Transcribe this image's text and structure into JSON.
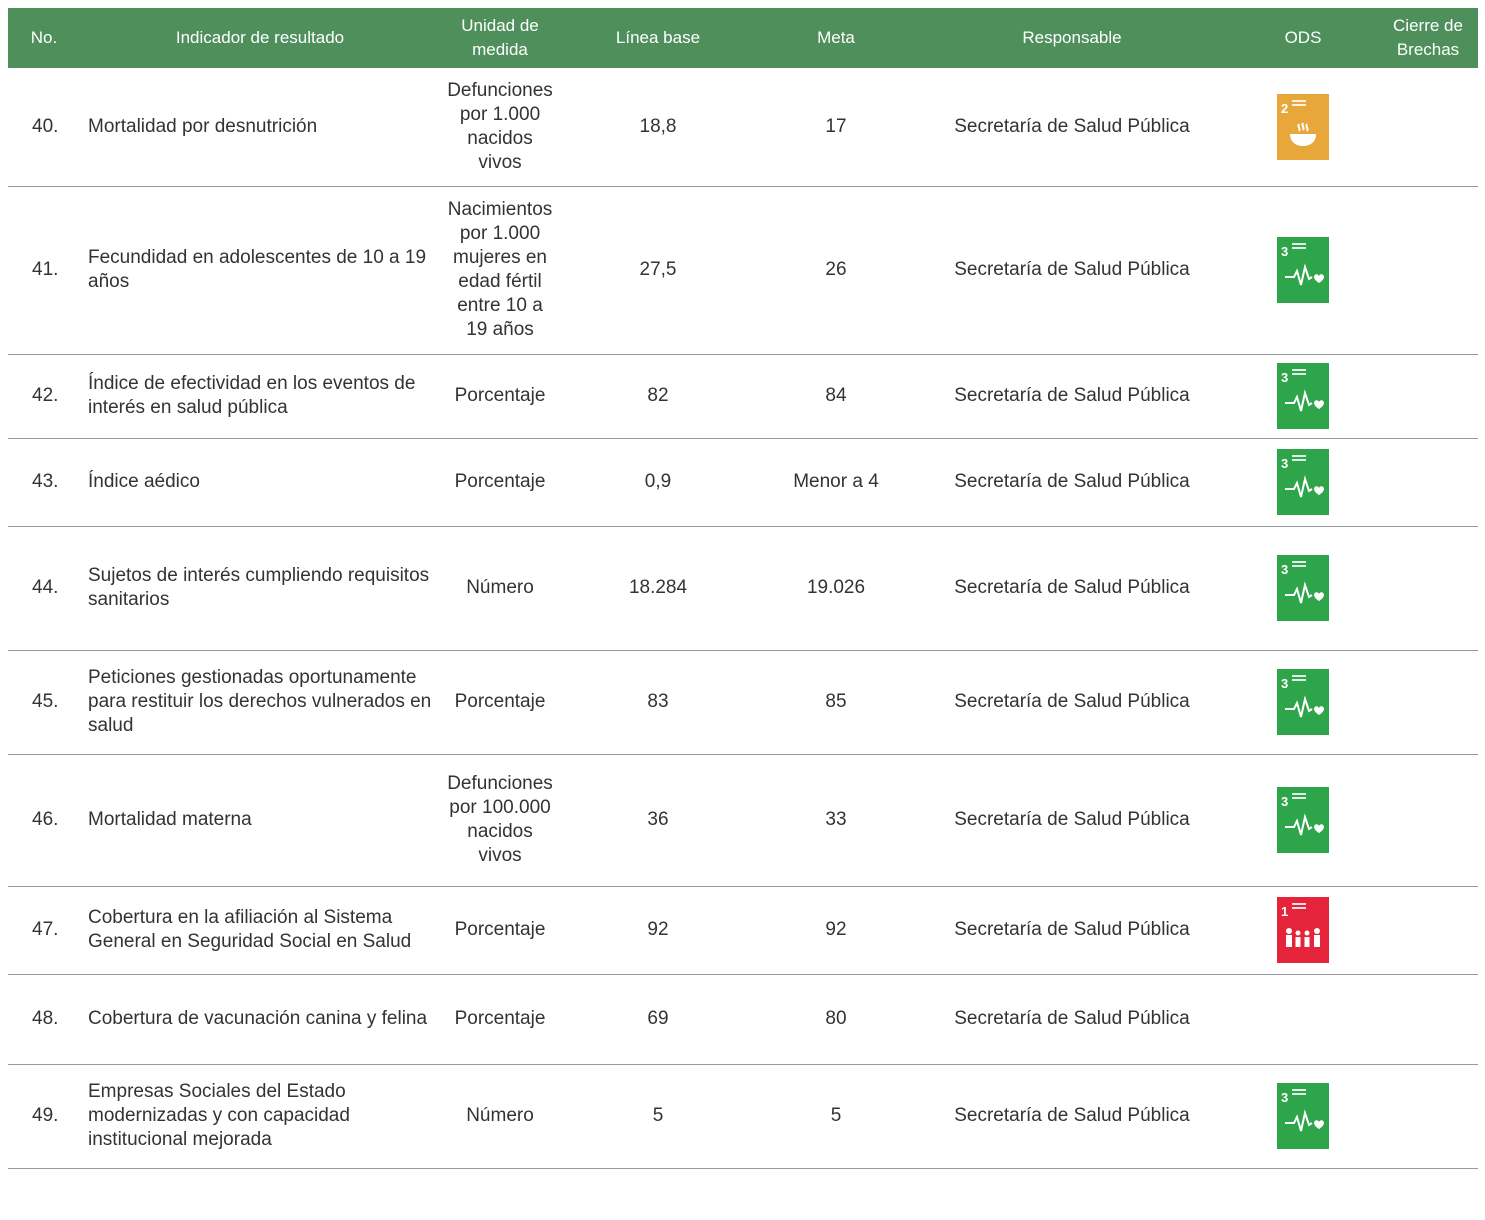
{
  "colors": {
    "header_bg": "#4f8f5c",
    "ods_2": "#e7a73b",
    "ods_3": "#2ea44b",
    "ods_1": "#e5243b"
  },
  "header": {
    "no": "No.",
    "indicador": "Indicador de resultado",
    "unidad": "Unidad de medida",
    "linea_base": "Línea base",
    "meta": "Meta",
    "responsable": "Responsable",
    "ods": "ODS",
    "cierre": "Cierre de Brechas"
  },
  "rows": [
    {
      "no": "40.",
      "indicador": "Mortalidad por desnutrición",
      "unidad": "Defunciones por 1.000 nacidos vivos",
      "linea_base": "18,8",
      "meta": "17",
      "responsable": "Secretaría de Salud Pública",
      "ods": {
        "number": "2",
        "icon": "bowl-icon",
        "color": "#e7a73b"
      }
    },
    {
      "no": "41.",
      "indicador": "Fecundidad en adolescentes de 10 a 19 años",
      "unidad": "Nacimientos por 1.000 mujeres en edad fértil entre 10 a 19 años",
      "linea_base": "27,5",
      "meta": "26",
      "responsable": "Secretaría de Salud Pública",
      "ods": {
        "number": "3",
        "icon": "heartbeat-icon",
        "color": "#2ea44b"
      }
    },
    {
      "no": "42.",
      "indicador": "Índice de efectividad en los eventos de interés en salud pública",
      "unidad": "Porcentaje",
      "linea_base": "82",
      "meta": "84",
      "responsable": "Secretaría de Salud Pública",
      "ods": {
        "number": "3",
        "icon": "heartbeat-icon",
        "color": "#2ea44b"
      }
    },
    {
      "no": "43.",
      "indicador": "Índice aédico",
      "unidad": "Porcentaje",
      "linea_base": "0,9",
      "meta": "Menor a 4",
      "responsable": "Secretaría de Salud Pública",
      "ods": {
        "number": "3",
        "icon": "heartbeat-icon",
        "color": "#2ea44b"
      }
    },
    {
      "no": "44.",
      "indicador": "Sujetos de interés cumpliendo requisitos sanitarios",
      "unidad": "Número",
      "linea_base": "18.284",
      "meta": "19.026",
      "responsable": "Secretaría de Salud Pública",
      "ods": {
        "number": "3",
        "icon": "heartbeat-icon",
        "color": "#2ea44b"
      }
    },
    {
      "no": "45.",
      "indicador": "Peticiones gestionadas oportunamente para restituir los derechos vulnerados en salud",
      "unidad": "Porcentaje",
      "linea_base": "83",
      "meta": "85",
      "responsable": "Secretaría de Salud Pública",
      "ods": {
        "number": "3",
        "icon": "heartbeat-icon",
        "color": "#2ea44b"
      }
    },
    {
      "no": "46.",
      "indicador": "Mortalidad materna",
      "unidad": "Defunciones por 100.000 nacidos vivos",
      "linea_base": "36",
      "meta": "33",
      "responsable": "Secretaría de Salud Pública",
      "ods": {
        "number": "3",
        "icon": "heartbeat-icon",
        "color": "#2ea44b"
      }
    },
    {
      "no": "47.",
      "indicador": "Cobertura en la afiliación al Sistema General en Seguridad Social en Salud",
      "unidad": "Porcentaje",
      "linea_base": "92",
      "meta": "92",
      "responsable": "Secretaría de Salud Pública",
      "ods": {
        "number": "1",
        "icon": "people-icon",
        "color": "#e5243b"
      }
    },
    {
      "no": "48.",
      "indicador": "Cobertura de vacunación canina y felina",
      "unidad": "Porcentaje",
      "linea_base": "69",
      "meta": "80",
      "responsable": "Secretaría de Salud Pública",
      "ods": null
    },
    {
      "no": "49.",
      "indicador": "Empresas Sociales del Estado modernizadas y con capacidad institucional mejorada",
      "unidad": "Número",
      "linea_base": "5",
      "meta": "5",
      "responsable": "Secretaría de Salud Pública",
      "ods": {
        "number": "3",
        "icon": "heartbeat-icon",
        "color": "#2ea44b"
      }
    }
  ]
}
